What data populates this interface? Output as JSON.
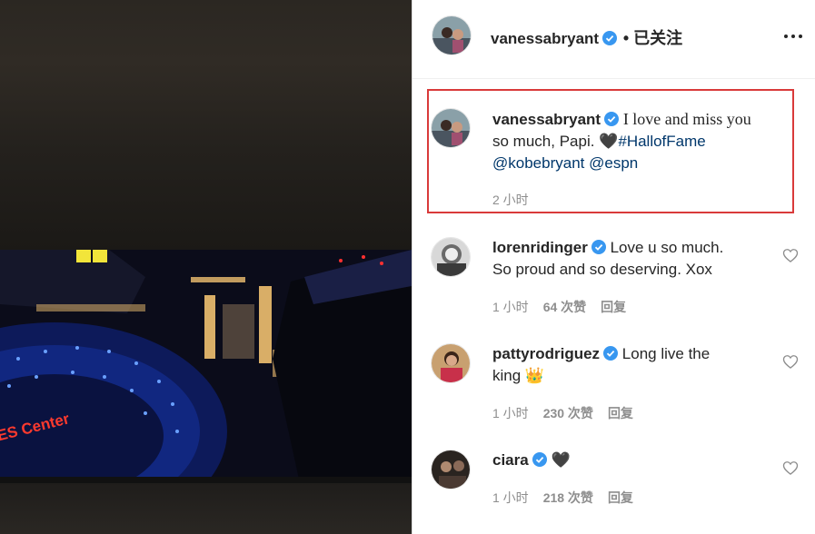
{
  "post": {
    "author": "vanessabryant",
    "follow_status": "• 已关注",
    "caption": {
      "author": "vanessabryant",
      "text_serif": "I love and miss you",
      "text_rest": "so much, Papi.",
      "heart": "🖤",
      "hashtag": "#HallofFame",
      "mention1": "@kobebryant",
      "mention2": "@espn",
      "time": "2 小时"
    },
    "media_sign": "ES Center"
  },
  "comments": [
    {
      "author": "lorenridinger",
      "line1": "Love u so much.",
      "line2": "So proud and so deserving. Xox",
      "time": "1 小时",
      "likes": "64 次赞",
      "reply": "回复"
    },
    {
      "author": "pattyrodriguez",
      "line1": "Long live the",
      "line2": "king 👑",
      "time": "1 小时",
      "likes": "230 次赞",
      "reply": "回复"
    },
    {
      "author": "ciara",
      "line1": "🖤",
      "line2": "",
      "time": "1 小时",
      "likes": "218 次赞",
      "reply": "回复"
    }
  ],
  "colors": {
    "verified": "#3897f0",
    "link": "#00376b",
    "highlight": "#d93a3a",
    "meta": "#8e8e8e"
  },
  "icons": {
    "more": "more-options-icon",
    "verified": "verified-badge-icon",
    "like": "heart-outline-icon"
  }
}
